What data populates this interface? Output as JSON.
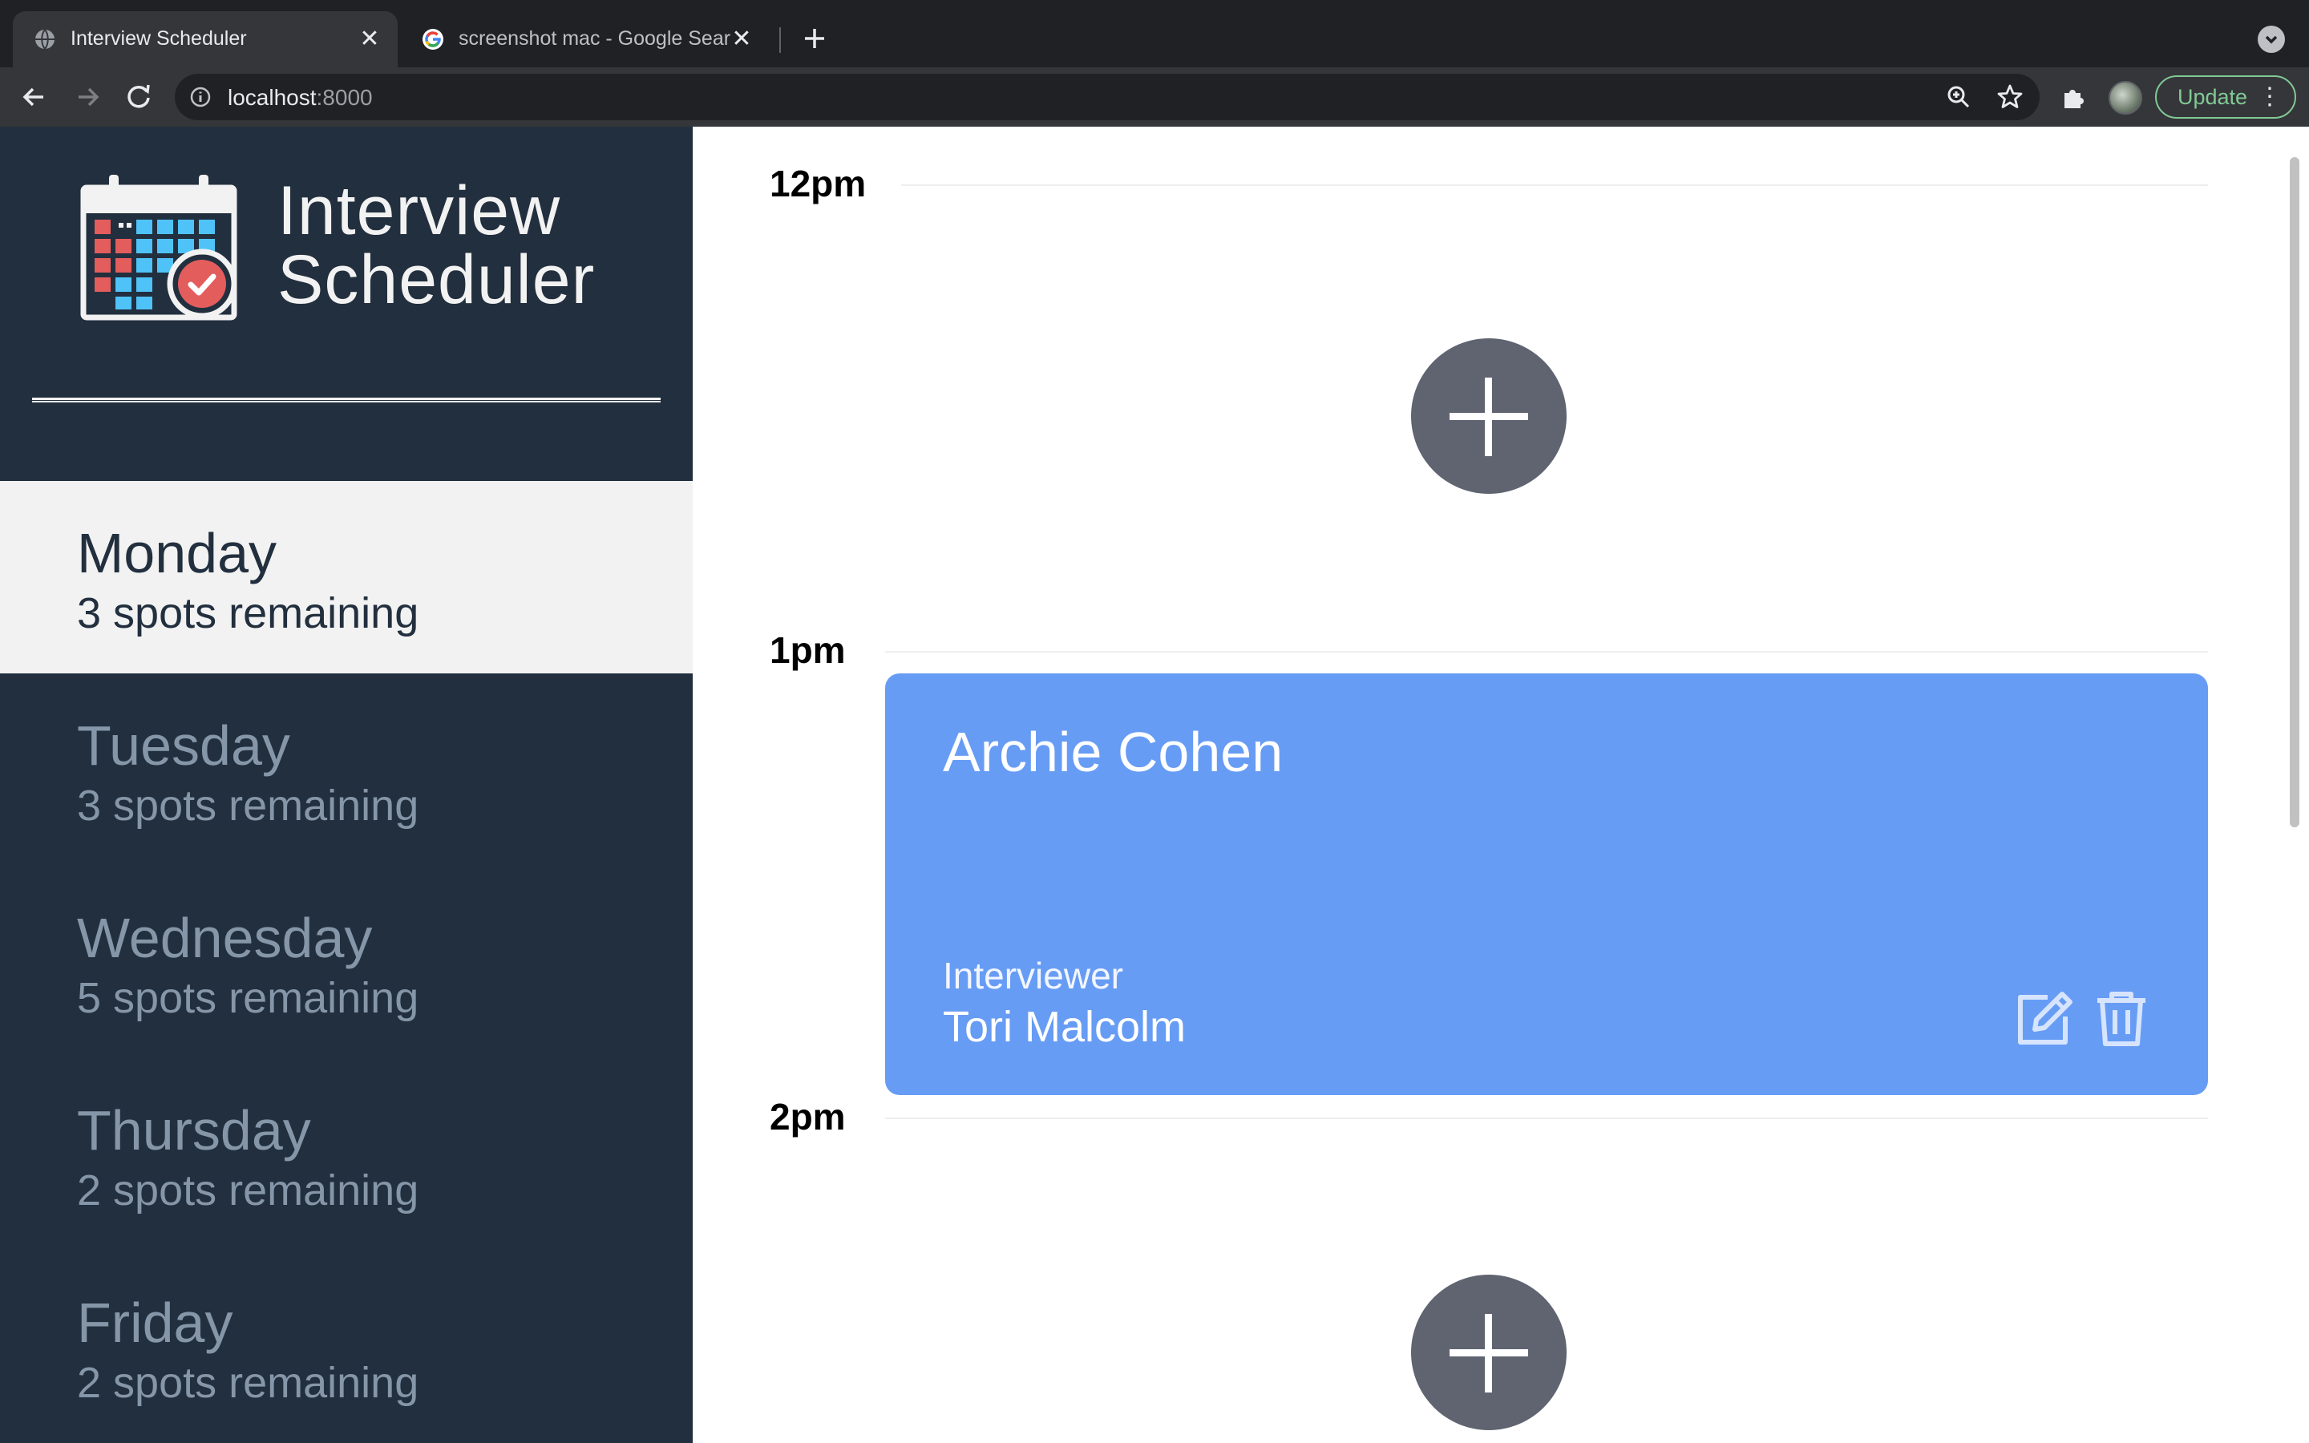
{
  "browser": {
    "tabs": [
      {
        "title": "Interview Scheduler",
        "close": "✕"
      },
      {
        "title": "screenshot mac - Google Search",
        "close": "✕"
      }
    ],
    "new_tab": "+",
    "url_host": "localhost",
    "url_port": ":8000",
    "update_label": "Update",
    "menu_dots": "⋮"
  },
  "sidebar": {
    "logo_line1": "Interview",
    "logo_line2": "Scheduler",
    "days": [
      {
        "name": "Monday",
        "spots": "3 spots remaining",
        "selected": true
      },
      {
        "name": "Tuesday",
        "spots": "3 spots remaining",
        "selected": false
      },
      {
        "name": "Wednesday",
        "spots": "5 spots remaining",
        "selected": false
      },
      {
        "name": "Thursday",
        "spots": "2 spots remaining",
        "selected": false
      },
      {
        "name": "Friday",
        "spots": "2 spots remaining",
        "selected": false
      }
    ]
  },
  "schedule": {
    "slots": [
      {
        "time": "12pm"
      },
      {
        "time": "1pm"
      },
      {
        "time": "2pm"
      }
    ],
    "appointment": {
      "student": "Archie Cohen",
      "interviewer_label": "Interviewer",
      "interviewer": "Tori Malcolm"
    }
  },
  "colors": {
    "sidebar_bg": "#222f3e",
    "selected_day_bg": "#f2f2f2",
    "appointment_bg": "#679cf5",
    "add_button_bg": "#5f6470"
  }
}
